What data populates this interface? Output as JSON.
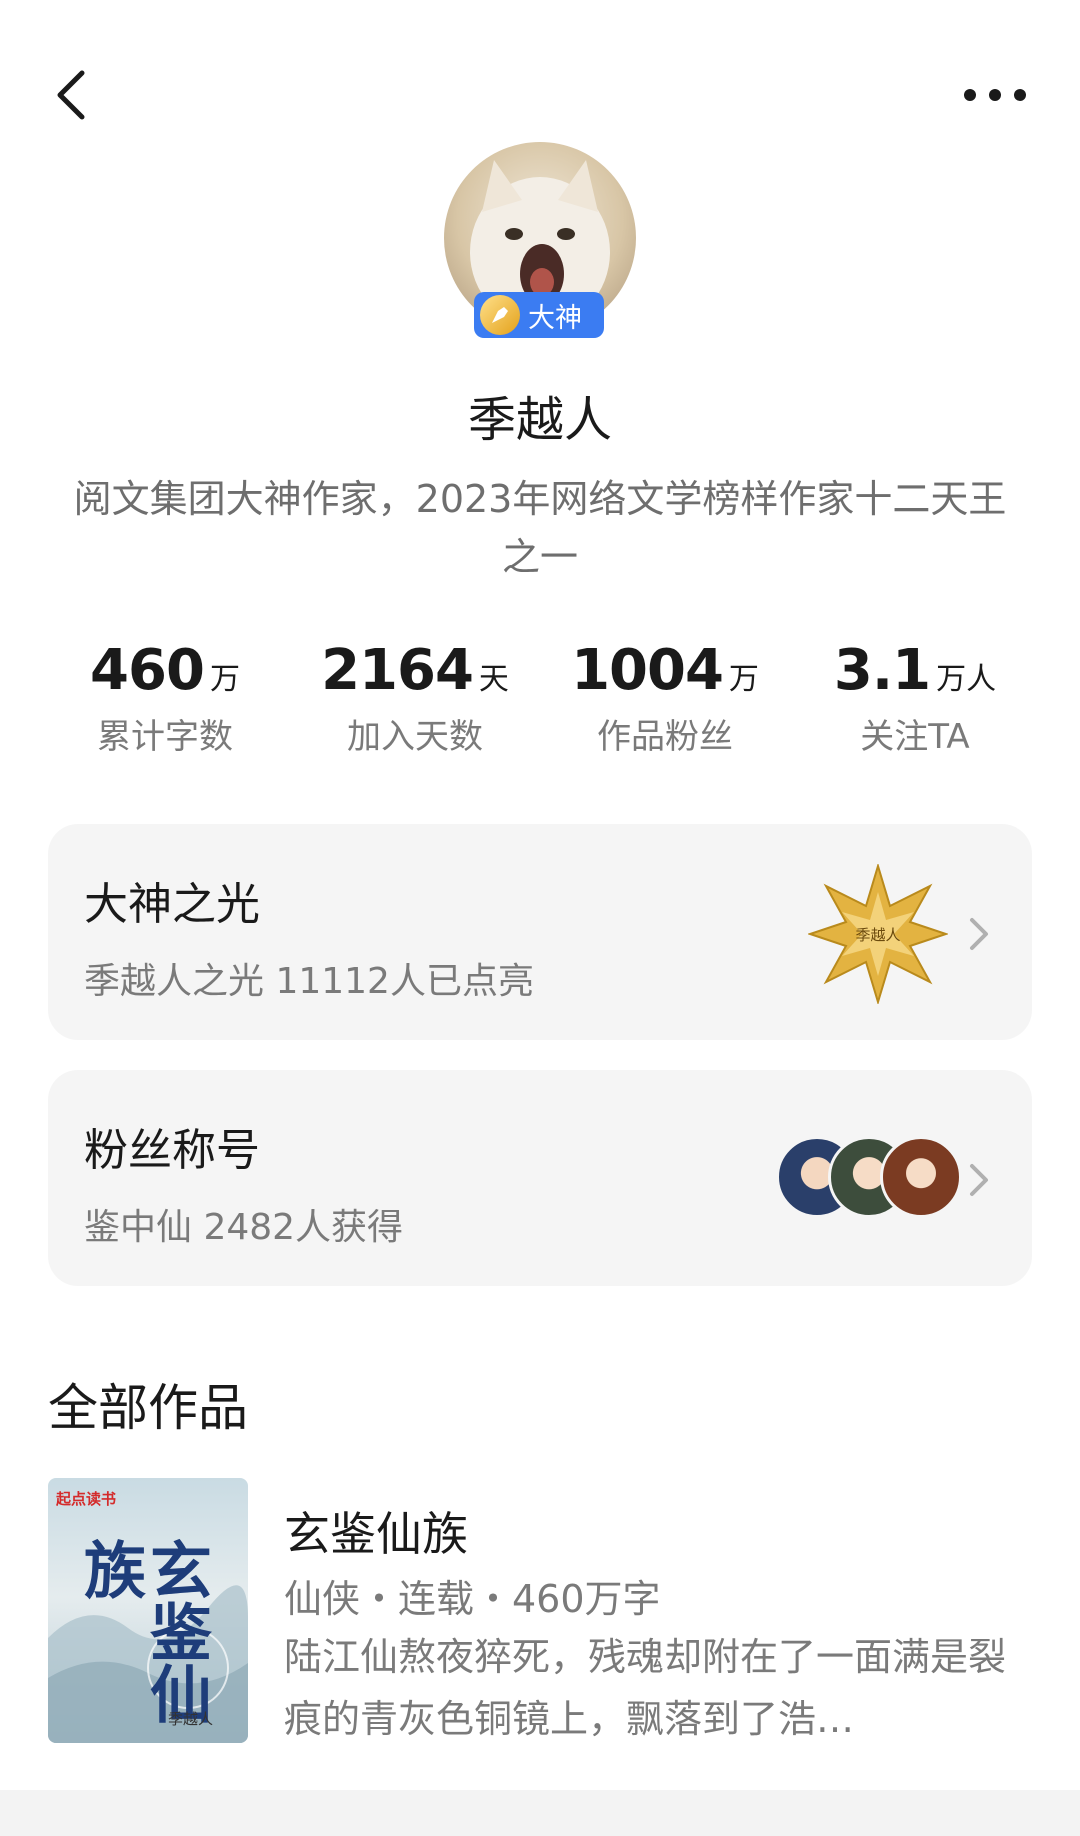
{
  "header": {
    "back_icon": "chevron-left-icon",
    "more_icon": "more-horizontal-icon"
  },
  "profile": {
    "badge_label": "大神",
    "name": "季越人",
    "bio": "阅文集团大神作家，2023年网络文学榜样作家十二天王之一"
  },
  "stats": [
    {
      "value": "460",
      "unit": "万",
      "label": "累计字数"
    },
    {
      "value": "2164",
      "unit": "天",
      "label": "加入天数"
    },
    {
      "value": "1004",
      "unit": "万",
      "label": "作品粉丝"
    },
    {
      "value": "3.1",
      "unit": "万人",
      "label": "关注TA"
    }
  ],
  "cards": {
    "light": {
      "title": "大神之光",
      "subtitle": "季越人之光 11112人已点亮",
      "medal_text": "季越人"
    },
    "fan_title": {
      "title": "粉丝称号",
      "subtitle": "鉴中仙 2482人获得"
    }
  },
  "works": {
    "section_title": "全部作品",
    "items": [
      {
        "title": "玄鉴仙族",
        "meta": "仙侠・连载・460万字",
        "description": "陆江仙熬夜猝死，残魂却附在了一面满是裂痕的青灰色铜镜上，飘落到了浩…",
        "cover_brand": "起点读书",
        "cover_title": "玄鉴仙族",
        "cover_author": "季越人"
      }
    ]
  },
  "colors": {
    "badge_blue": "#3b7cf2",
    "card_bg": "#f5f5f5",
    "muted_text": "#7a7a7a",
    "medal_gold": "#e3b341"
  }
}
